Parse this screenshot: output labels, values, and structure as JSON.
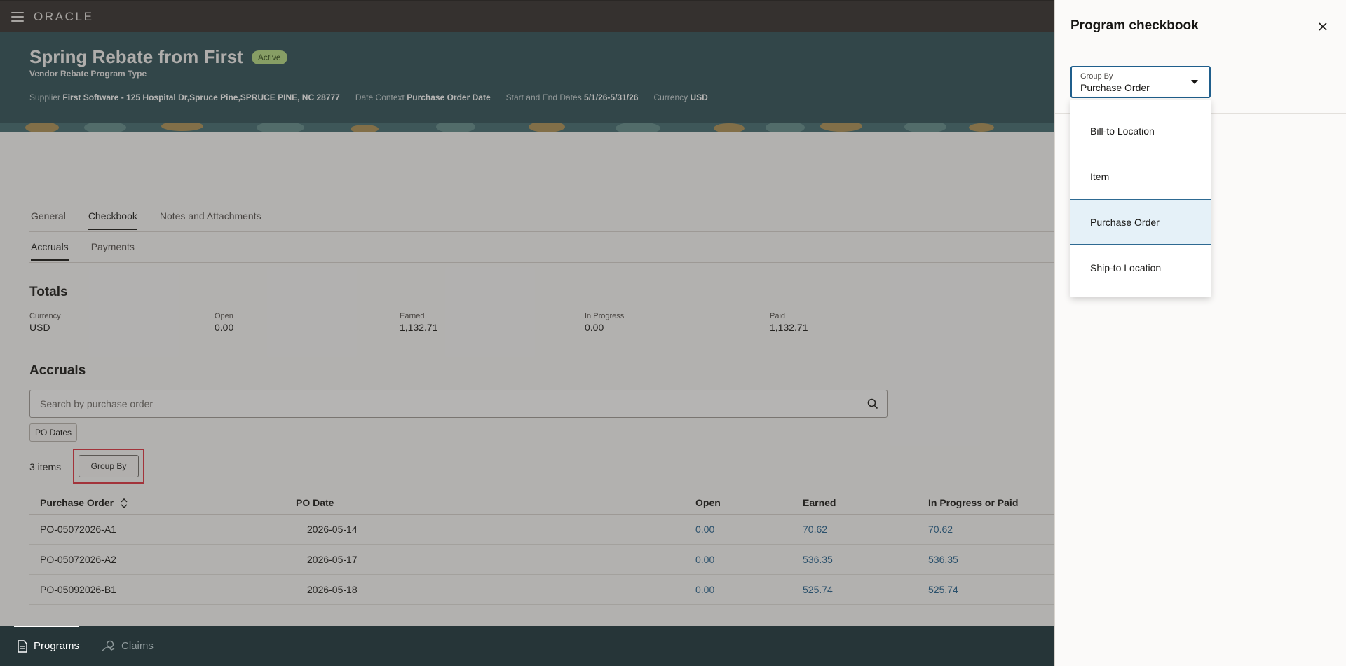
{
  "topbar": {
    "logo": "ORACLE"
  },
  "header": {
    "title": "Spring Rebate from First",
    "status": "Active",
    "subtitle": "Vendor Rebate Program Type",
    "supplier_label": "Supplier",
    "supplier_value": "First Software - 125 Hospital Dr,Spruce Pine,SPRUCE PINE, NC 28777",
    "date_context_label": "Date Context",
    "date_context_value": "Purchase Order Date",
    "dates_label": "Start and End Dates",
    "dates_value": "5/1/26-5/31/26",
    "currency_label": "Currency",
    "currency_value": "USD"
  },
  "tabs": [
    "General",
    "Checkbook",
    "Notes and Attachments"
  ],
  "subtabs": [
    "Accruals",
    "Payments"
  ],
  "totals": {
    "heading": "Totals",
    "items": [
      {
        "label": "Currency",
        "value": "USD"
      },
      {
        "label": "Open",
        "value": "0.00"
      },
      {
        "label": "Earned",
        "value": "1,132.71"
      },
      {
        "label": "In Progress",
        "value": "0.00"
      },
      {
        "label": "Paid",
        "value": "1,132.71"
      }
    ]
  },
  "accruals": {
    "heading": "Accruals",
    "search_placeholder": "Search by purchase order",
    "chip": "PO Dates",
    "items_count": "3 items",
    "group_by_button": "Group By"
  },
  "table": {
    "headers": [
      "Purchase Order",
      "PO Date",
      "Open",
      "Earned",
      "In Progress or Paid"
    ],
    "rows": [
      [
        "PO-05072026-A1",
        "2026-05-14",
        "0.00",
        "70.62",
        "70.62"
      ],
      [
        "PO-05072026-A2",
        "2026-05-17",
        "0.00",
        "536.35",
        "536.35"
      ],
      [
        "PO-05092026-B1",
        "2026-05-18",
        "0.00",
        "525.74",
        "525.74"
      ]
    ]
  },
  "bottomnav": {
    "programs": "Programs",
    "claims": "Claims"
  },
  "drawer": {
    "title": "Program checkbook",
    "select_label": "Group By",
    "select_value": "Purchase Order",
    "options": [
      "Bill-to Location",
      "Item",
      "Purchase Order",
      "Ship-to Location"
    ]
  },
  "colors": {
    "header_bg": "#2d4e54",
    "accent": "#1f5e8c",
    "highlight": "#e0303d",
    "badge": "#b5dc82"
  }
}
